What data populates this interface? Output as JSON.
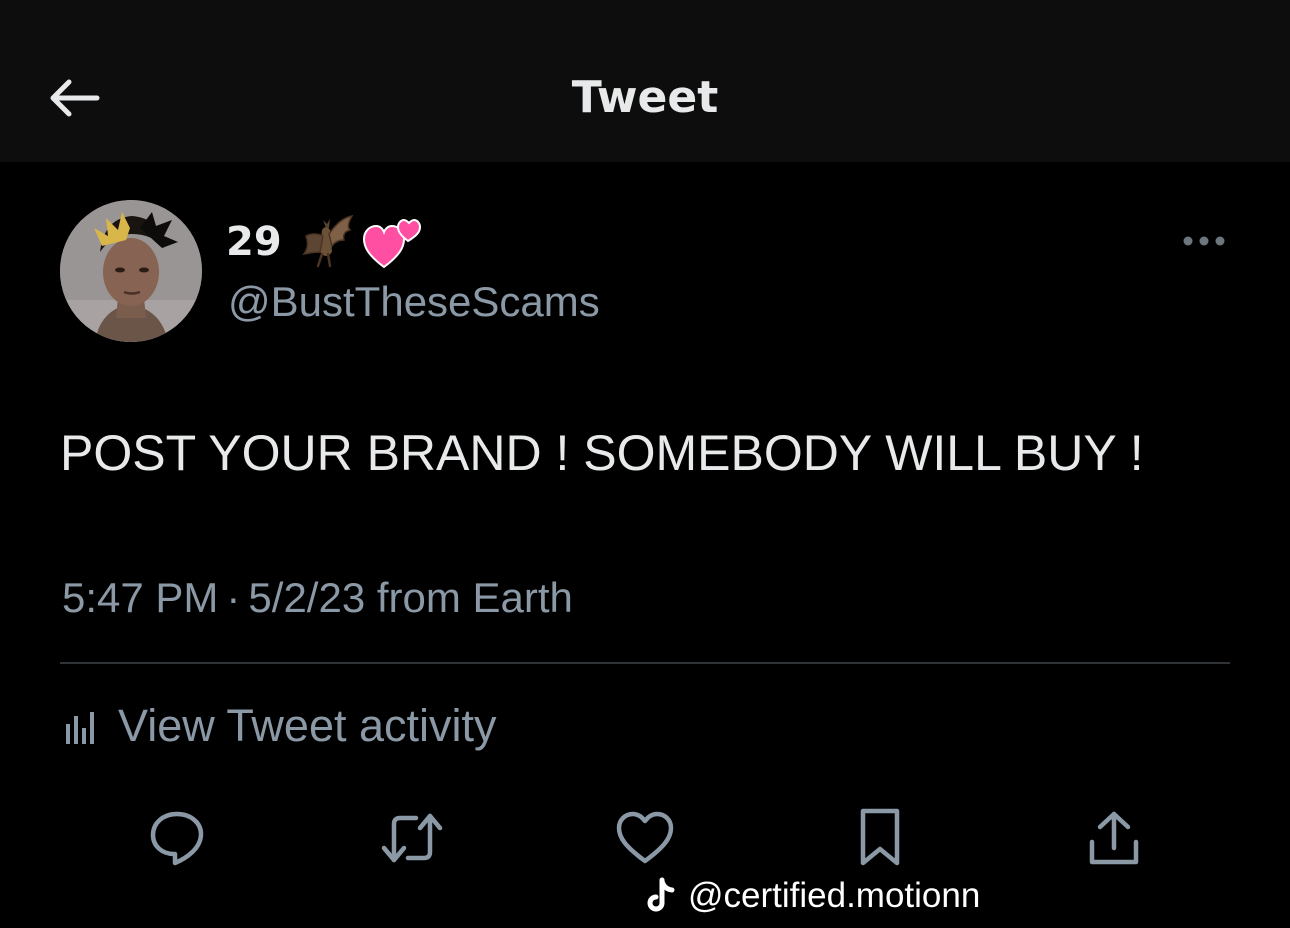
{
  "header": {
    "title": "Tweet"
  },
  "author": {
    "display_name": "29",
    "name_emojis": [
      "bat-emoji",
      "two-hearts-emoji"
    ],
    "handle": "@BustTheseScams"
  },
  "tweet": {
    "text": "POST YOUR BRAND ! SOMEBODY WILL BUY !",
    "time": "5:47 PM",
    "separator": "·",
    "date_source": "5/2/23 from Earth"
  },
  "activity": {
    "label": "View Tweet activity"
  },
  "actions": [
    "reply-icon",
    "retweet-icon",
    "like-icon",
    "bookmark-icon",
    "share-icon"
  ],
  "watermark": {
    "text": "@certified.motionn"
  },
  "colors": {
    "background": "#000000",
    "header_background": "#0d0d0d",
    "primary_text": "#e7e9ea",
    "secondary_text": "#8b98a5",
    "divider": "#2f3336",
    "heart_pink": "#ff4fa3"
  }
}
